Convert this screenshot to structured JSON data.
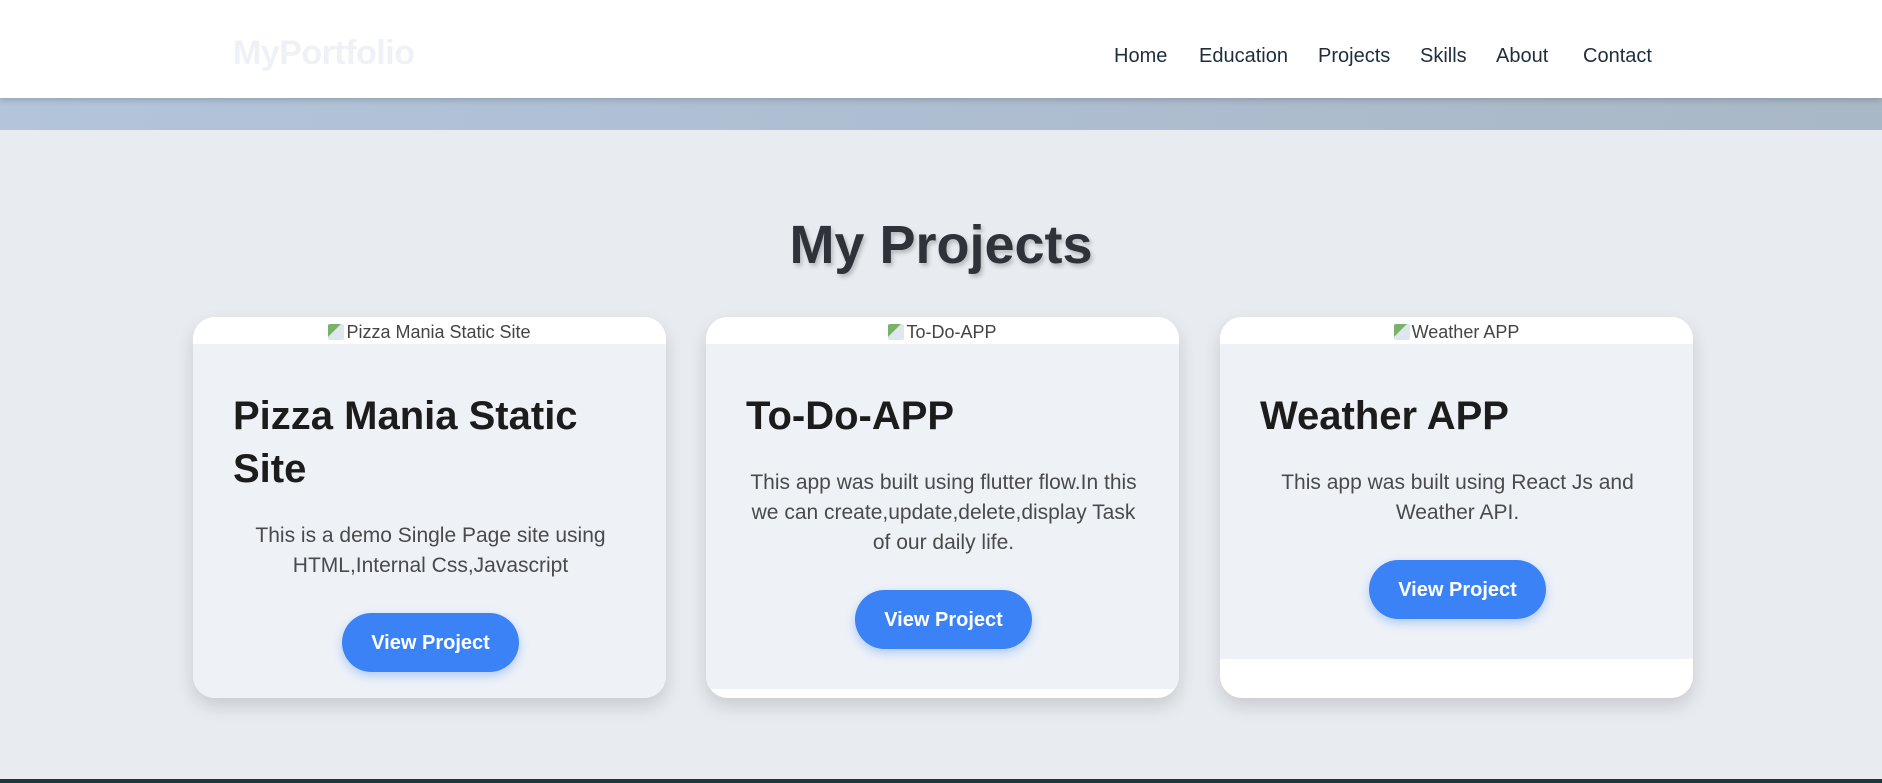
{
  "navbar": {
    "logo": "MyPortfolio",
    "links": [
      "Home",
      "Education",
      "Projects",
      "Skills",
      "About",
      "Contact"
    ]
  },
  "projects_section": {
    "title": "My Projects",
    "cards": [
      {
        "image_alt": "Pizza Mania Static Site",
        "title": "Pizza Mania Static Site",
        "description": "This is a demo Single Page site using HTML,Internal Css,Javascript",
        "button_label": "View Project"
      },
      {
        "image_alt": "To-Do-APP",
        "title": "To-Do-APP",
        "description": "This app was built using flutter flow.In this we can create,update,delete,display Task of our daily life.",
        "button_label": "View Project"
      },
      {
        "image_alt": "Weather APP",
        "title": "Weather APP",
        "description": "This app was built using React Js and Weather API.",
        "button_label": "View Project"
      }
    ]
  },
  "colors": {
    "accent": "#3b82f6",
    "page_background": "#e8ecf0",
    "card_body": "#eef2f7"
  },
  "icons": {
    "card_image": "broken-image-icon"
  }
}
